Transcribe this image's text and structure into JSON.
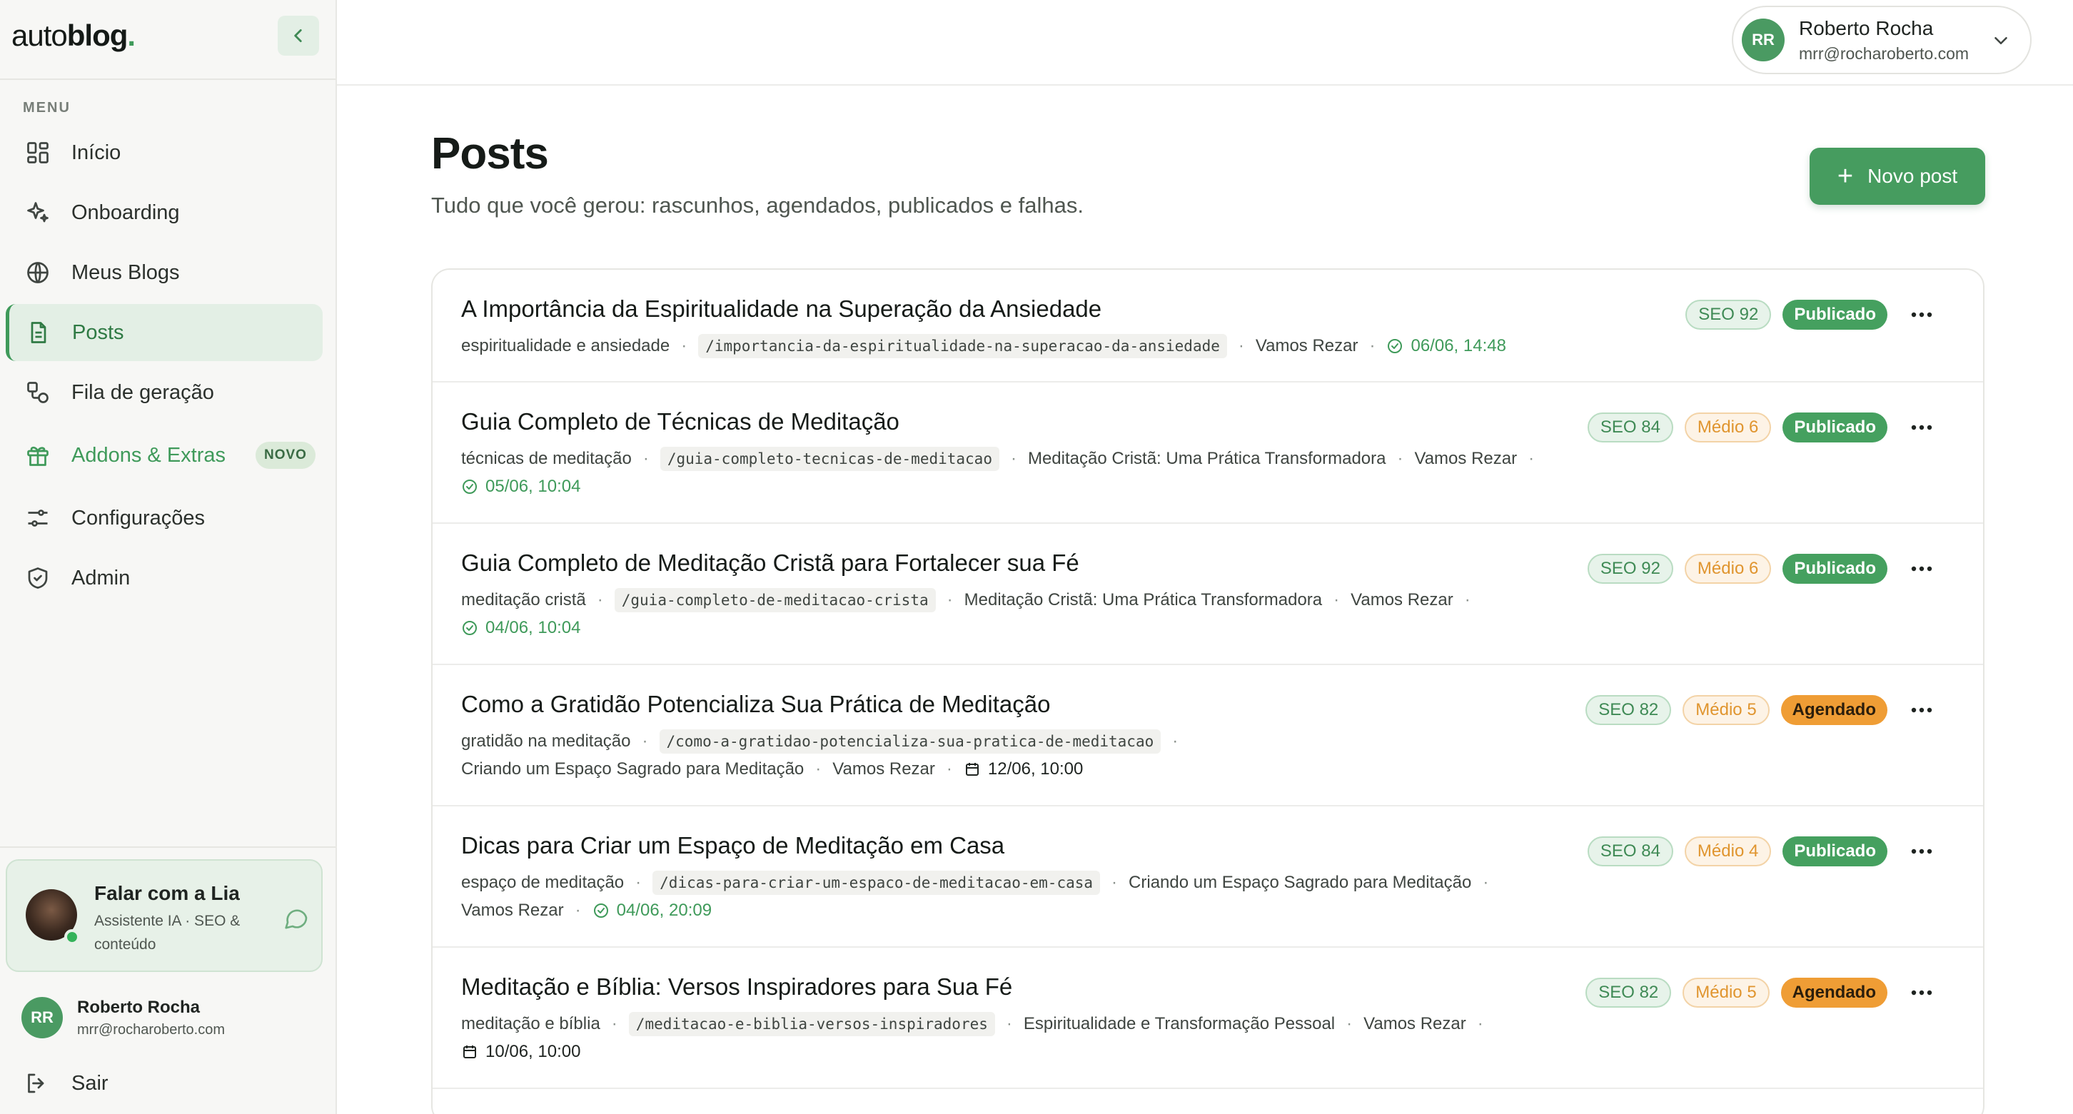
{
  "brand": {
    "part1": "auto",
    "part2": "blog",
    "dot": "."
  },
  "sidebar": {
    "menu_label": "MENU",
    "items": [
      {
        "label": "Início",
        "icon": "grid-icon"
      },
      {
        "label": "Onboarding",
        "icon": "sparkle-icon"
      },
      {
        "label": "Meus Blogs",
        "icon": "globe-icon"
      },
      {
        "label": "Posts",
        "icon": "document-icon",
        "active": true
      },
      {
        "label": "Fila de geração",
        "icon": "queue-icon"
      },
      {
        "label": "Addons & Extras",
        "icon": "gift-icon",
        "badge": "NOVO"
      },
      {
        "label": "Configurações",
        "icon": "sliders-icon"
      },
      {
        "label": "Admin",
        "icon": "shield-icon"
      }
    ],
    "lia": {
      "title": "Falar com a Lia",
      "subtitle": "Assistente IA · SEO & conteúdo"
    },
    "user": {
      "initials": "RR",
      "name": "Roberto Rocha",
      "email": "mrr@rocharoberto.com"
    },
    "logout_label": "Sair"
  },
  "header": {
    "user": {
      "initials": "RR",
      "name": "Roberto Rocha",
      "email": "mrr@rocharoberto.com"
    }
  },
  "main": {
    "title": "Posts",
    "subtitle": "Tudo que você gerou: rascunhos, agendados, publicados e falhas.",
    "new_post_label": "Novo post"
  },
  "posts": [
    {
      "title": "A Importância da Espiritualidade na Superação da Ansiedade",
      "keyword": "espiritualidade e ansiedade",
      "slug": "/importancia-da-espiritualidade-na-superacao-da-ansiedade",
      "blog": "Vamos Rezar",
      "date": "06/06, 14:48",
      "seo": "SEO 92",
      "status": "Publicado"
    },
    {
      "title": "Guia Completo de Técnicas de Meditação",
      "keyword": "técnicas de meditação",
      "slug": "/guia-completo-tecnicas-de-meditacao",
      "cluster": "Meditação Cristã: Uma Prática Transformadora",
      "blog": "Vamos Rezar",
      "date": "05/06, 10:04",
      "seo": "SEO 84",
      "level": "Médio 6",
      "status": "Publicado"
    },
    {
      "title": "Guia Completo de Meditação Cristã para Fortalecer sua Fé",
      "keyword": "meditação cristã",
      "slug": "/guia-completo-de-meditacao-crista",
      "cluster": "Meditação Cristã: Uma Prática Transformadora",
      "blog": "Vamos Rezar",
      "date": "04/06, 10:04",
      "seo": "SEO 92",
      "level": "Médio 6",
      "status": "Publicado"
    },
    {
      "title": "Como a Gratidão Potencializa Sua Prática de Meditação",
      "keyword": "gratidão na meditação",
      "slug": "/como-a-gratidao-potencializa-sua-pratica-de-meditacao",
      "cluster": "Criando um Espaço Sagrado para Meditação",
      "blog": "Vamos Rezar",
      "date": "12/06, 10:00",
      "seo": "SEO 82",
      "level": "Médio 5",
      "status": "Agendado"
    },
    {
      "title": "Dicas para Criar um Espaço de Meditação em Casa",
      "keyword": "espaço de meditação",
      "slug": "/dicas-para-criar-um-espaco-de-meditacao-em-casa",
      "cluster": "Criando um Espaço Sagrado para Meditação",
      "blog": "Vamos Rezar",
      "date": "04/06, 20:09",
      "seo": "SEO 84",
      "level": "Médio 4",
      "status": "Publicado"
    },
    {
      "title": "Meditação e Bíblia: Versos Inspiradores para Sua Fé",
      "keyword": "meditação e bíblia",
      "slug": "/meditacao-e-biblia-versos-inspiradores",
      "cluster": "Espiritualidade e Transformação Pessoal",
      "blog": "Vamos Rezar",
      "date": "10/06, 10:00",
      "seo": "SEO 82",
      "level": "Médio 5",
      "status": "Agendado"
    }
  ],
  "colors": {
    "accent": "#469c5f",
    "published": "#45a05f",
    "scheduled": "#ef9d35",
    "medium": "#e0952f"
  }
}
